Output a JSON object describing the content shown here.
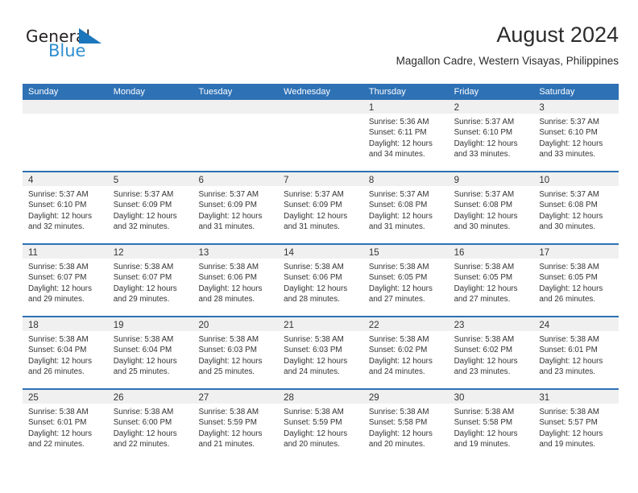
{
  "logo": {
    "word_primary": "General",
    "word_secondary": "Blue",
    "triangle_icon": "triangle-icon",
    "primary_color": "#231f20",
    "secondary_color": "#2f8fd0",
    "triangle_color": "#1b76bc"
  },
  "header": {
    "title": "August 2024",
    "subtitle": "Magallon Cadre, Western Visayas, Philippines"
  },
  "theme": {
    "header_blue": "#2e71b5",
    "numband_gray": "#f0f0f0",
    "text_color": "#333333",
    "page_background": "#ffffff"
  },
  "weekday_headers": [
    "Sunday",
    "Monday",
    "Tuesday",
    "Wednesday",
    "Thursday",
    "Friday",
    "Saturday"
  ],
  "weeks": [
    [
      {
        "day": "",
        "sunrise": "",
        "sunset": "",
        "daylight_1": "",
        "daylight_2": "",
        "empty": true
      },
      {
        "day": "",
        "sunrise": "",
        "sunset": "",
        "daylight_1": "",
        "daylight_2": "",
        "empty": true
      },
      {
        "day": "",
        "sunrise": "",
        "sunset": "",
        "daylight_1": "",
        "daylight_2": "",
        "empty": true
      },
      {
        "day": "",
        "sunrise": "",
        "sunset": "",
        "daylight_1": "",
        "daylight_2": "",
        "empty": true
      },
      {
        "day": "1",
        "sunrise": "Sunrise: 5:36 AM",
        "sunset": "Sunset: 6:11 PM",
        "daylight_1": "Daylight: 12 hours",
        "daylight_2": "and 34 minutes."
      },
      {
        "day": "2",
        "sunrise": "Sunrise: 5:37 AM",
        "sunset": "Sunset: 6:10 PM",
        "daylight_1": "Daylight: 12 hours",
        "daylight_2": "and 33 minutes."
      },
      {
        "day": "3",
        "sunrise": "Sunrise: 5:37 AM",
        "sunset": "Sunset: 6:10 PM",
        "daylight_1": "Daylight: 12 hours",
        "daylight_2": "and 33 minutes."
      }
    ],
    [
      {
        "day": "4",
        "sunrise": "Sunrise: 5:37 AM",
        "sunset": "Sunset: 6:10 PM",
        "daylight_1": "Daylight: 12 hours",
        "daylight_2": "and 32 minutes."
      },
      {
        "day": "5",
        "sunrise": "Sunrise: 5:37 AM",
        "sunset": "Sunset: 6:09 PM",
        "daylight_1": "Daylight: 12 hours",
        "daylight_2": "and 32 minutes."
      },
      {
        "day": "6",
        "sunrise": "Sunrise: 5:37 AM",
        "sunset": "Sunset: 6:09 PM",
        "daylight_1": "Daylight: 12 hours",
        "daylight_2": "and 31 minutes."
      },
      {
        "day": "7",
        "sunrise": "Sunrise: 5:37 AM",
        "sunset": "Sunset: 6:09 PM",
        "daylight_1": "Daylight: 12 hours",
        "daylight_2": "and 31 minutes."
      },
      {
        "day": "8",
        "sunrise": "Sunrise: 5:37 AM",
        "sunset": "Sunset: 6:08 PM",
        "daylight_1": "Daylight: 12 hours",
        "daylight_2": "and 31 minutes."
      },
      {
        "day": "9",
        "sunrise": "Sunrise: 5:37 AM",
        "sunset": "Sunset: 6:08 PM",
        "daylight_1": "Daylight: 12 hours",
        "daylight_2": "and 30 minutes."
      },
      {
        "day": "10",
        "sunrise": "Sunrise: 5:37 AM",
        "sunset": "Sunset: 6:08 PM",
        "daylight_1": "Daylight: 12 hours",
        "daylight_2": "and 30 minutes."
      }
    ],
    [
      {
        "day": "11",
        "sunrise": "Sunrise: 5:38 AM",
        "sunset": "Sunset: 6:07 PM",
        "daylight_1": "Daylight: 12 hours",
        "daylight_2": "and 29 minutes."
      },
      {
        "day": "12",
        "sunrise": "Sunrise: 5:38 AM",
        "sunset": "Sunset: 6:07 PM",
        "daylight_1": "Daylight: 12 hours",
        "daylight_2": "and 29 minutes."
      },
      {
        "day": "13",
        "sunrise": "Sunrise: 5:38 AM",
        "sunset": "Sunset: 6:06 PM",
        "daylight_1": "Daylight: 12 hours",
        "daylight_2": "and 28 minutes."
      },
      {
        "day": "14",
        "sunrise": "Sunrise: 5:38 AM",
        "sunset": "Sunset: 6:06 PM",
        "daylight_1": "Daylight: 12 hours",
        "daylight_2": "and 28 minutes."
      },
      {
        "day": "15",
        "sunrise": "Sunrise: 5:38 AM",
        "sunset": "Sunset: 6:05 PM",
        "daylight_1": "Daylight: 12 hours",
        "daylight_2": "and 27 minutes."
      },
      {
        "day": "16",
        "sunrise": "Sunrise: 5:38 AM",
        "sunset": "Sunset: 6:05 PM",
        "daylight_1": "Daylight: 12 hours",
        "daylight_2": "and 27 minutes."
      },
      {
        "day": "17",
        "sunrise": "Sunrise: 5:38 AM",
        "sunset": "Sunset: 6:05 PM",
        "daylight_1": "Daylight: 12 hours",
        "daylight_2": "and 26 minutes."
      }
    ],
    [
      {
        "day": "18",
        "sunrise": "Sunrise: 5:38 AM",
        "sunset": "Sunset: 6:04 PM",
        "daylight_1": "Daylight: 12 hours",
        "daylight_2": "and 26 minutes."
      },
      {
        "day": "19",
        "sunrise": "Sunrise: 5:38 AM",
        "sunset": "Sunset: 6:04 PM",
        "daylight_1": "Daylight: 12 hours",
        "daylight_2": "and 25 minutes."
      },
      {
        "day": "20",
        "sunrise": "Sunrise: 5:38 AM",
        "sunset": "Sunset: 6:03 PM",
        "daylight_1": "Daylight: 12 hours",
        "daylight_2": "and 25 minutes."
      },
      {
        "day": "21",
        "sunrise": "Sunrise: 5:38 AM",
        "sunset": "Sunset: 6:03 PM",
        "daylight_1": "Daylight: 12 hours",
        "daylight_2": "and 24 minutes."
      },
      {
        "day": "22",
        "sunrise": "Sunrise: 5:38 AM",
        "sunset": "Sunset: 6:02 PM",
        "daylight_1": "Daylight: 12 hours",
        "daylight_2": "and 24 minutes."
      },
      {
        "day": "23",
        "sunrise": "Sunrise: 5:38 AM",
        "sunset": "Sunset: 6:02 PM",
        "daylight_1": "Daylight: 12 hours",
        "daylight_2": "and 23 minutes."
      },
      {
        "day": "24",
        "sunrise": "Sunrise: 5:38 AM",
        "sunset": "Sunset: 6:01 PM",
        "daylight_1": "Daylight: 12 hours",
        "daylight_2": "and 23 minutes."
      }
    ],
    [
      {
        "day": "25",
        "sunrise": "Sunrise: 5:38 AM",
        "sunset": "Sunset: 6:01 PM",
        "daylight_1": "Daylight: 12 hours",
        "daylight_2": "and 22 minutes."
      },
      {
        "day": "26",
        "sunrise": "Sunrise: 5:38 AM",
        "sunset": "Sunset: 6:00 PM",
        "daylight_1": "Daylight: 12 hours",
        "daylight_2": "and 22 minutes."
      },
      {
        "day": "27",
        "sunrise": "Sunrise: 5:38 AM",
        "sunset": "Sunset: 5:59 PM",
        "daylight_1": "Daylight: 12 hours",
        "daylight_2": "and 21 minutes."
      },
      {
        "day": "28",
        "sunrise": "Sunrise: 5:38 AM",
        "sunset": "Sunset: 5:59 PM",
        "daylight_1": "Daylight: 12 hours",
        "daylight_2": "and 20 minutes."
      },
      {
        "day": "29",
        "sunrise": "Sunrise: 5:38 AM",
        "sunset": "Sunset: 5:58 PM",
        "daylight_1": "Daylight: 12 hours",
        "daylight_2": "and 20 minutes."
      },
      {
        "day": "30",
        "sunrise": "Sunrise: 5:38 AM",
        "sunset": "Sunset: 5:58 PM",
        "daylight_1": "Daylight: 12 hours",
        "daylight_2": "and 19 minutes."
      },
      {
        "day": "31",
        "sunrise": "Sunrise: 5:38 AM",
        "sunset": "Sunset: 5:57 PM",
        "daylight_1": "Daylight: 12 hours",
        "daylight_2": "and 19 minutes."
      }
    ]
  ]
}
